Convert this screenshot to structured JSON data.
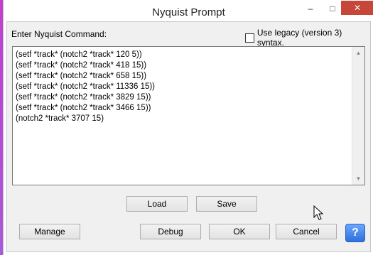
{
  "window": {
    "title": "Nyquist Prompt",
    "controls": {
      "minimize": "–",
      "maximize": "□",
      "close": "✕"
    }
  },
  "prompt": {
    "label": "Enter Nyquist Command:",
    "legacy_checkbox": {
      "label": "Use legacy (version 3) syntax.",
      "checked": false
    }
  },
  "editor": {
    "lines": [
      "(setf *track* (notch2 *track* 120 5))",
      "(setf *track* (notch2 *track* 418 15))",
      "(setf *track* (notch2 *track* 658 15))",
      "(setf *track* (notch2 *track* 11336 15))",
      "(setf *track* (notch2 *track* 3829 15))",
      "(setf *track* (notch2 *track* 3466 15))",
      "(notch2 *track* 3707 15)"
    ]
  },
  "buttons": {
    "load": "Load",
    "save": "Save",
    "manage": "Manage",
    "debug": "Debug",
    "ok": "OK",
    "cancel": "Cancel",
    "help": "?"
  },
  "colors": {
    "close_button": "#c7463a",
    "help_button": "#2f6fdc",
    "dialog_bg": "#f0f0f0"
  }
}
